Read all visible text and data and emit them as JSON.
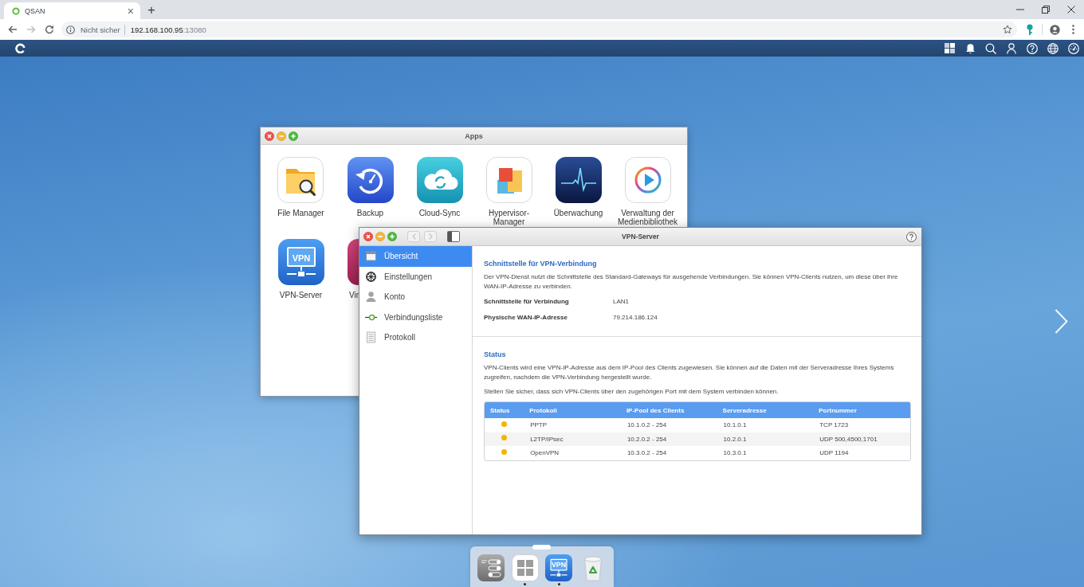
{
  "browser": {
    "tab": {
      "title": "QSAN",
      "close": "×"
    },
    "new_tab": "+",
    "forward_disabled": true,
    "address": {
      "security": "Nicht sicher",
      "host": "192.168.100.95",
      "port": ":13080"
    }
  },
  "apps_window": {
    "title": "Apps",
    "apps": [
      {
        "label": "File Manager",
        "kind": "files"
      },
      {
        "label": "Backup",
        "kind": "backup"
      },
      {
        "label": "Cloud-Sync",
        "kind": "cloud"
      },
      {
        "label": "Hypervisor-Manager",
        "kind": "hypervisor"
      },
      {
        "label": "Überwachung",
        "kind": "monitor"
      },
      {
        "label": "Verwaltung der Medienbibliothek",
        "kind": "media"
      },
      {
        "label": "VPN-Server",
        "kind": "vpn",
        "badge": "VPN"
      },
      {
        "label": "Vir",
        "kind": "partial"
      }
    ]
  },
  "vpn_window": {
    "title": "VPN-Server",
    "back_disabled": true,
    "forward_disabled": true,
    "sidebar": [
      {
        "label": "Übersicht",
        "kind": "overview",
        "selected": true
      },
      {
        "label": "Einstellungen",
        "kind": "settings",
        "selected": false
      },
      {
        "label": "Konto",
        "kind": "account",
        "selected": false
      },
      {
        "label": "Verbindungsliste",
        "kind": "connections",
        "selected": false
      },
      {
        "label": "Protokoll",
        "kind": "log",
        "selected": false
      }
    ],
    "interface": {
      "heading": "Schnittstelle für VPN-Verbindung",
      "text": "Der VPN-Dienst nutzt die Schnittstelle des Standard-Gateways für ausgehende Verbindungen. Sie können VPN-Clients nutzen, um diese über ihre WAN-IP-Adresse zu verbinden.",
      "fields": [
        {
          "label": "Schnittstelle für Verbindung",
          "value": "LAN1"
        },
        {
          "label": "Physische WAN-IP-Adresse",
          "value": "79.214.186.124"
        }
      ]
    },
    "status": {
      "heading": "Status",
      "paragraphs": [
        "VPN-Clients wird eine VPN-IP-Adresse aus dem IP-Pool des Clients zugewiesen. Sie können auf die Daten mit der Serveradresse Ihres Systems zugreifen, nachdem die VPN-Verbindung hergestellt wurde.",
        "Stellen Sie sicher, dass sich VPN-Clients über den zugehörigen Port mit dem System verbinden können."
      ],
      "table": {
        "columns": [
          "Status",
          "Protokoll",
          "IP-Pool des Clients",
          "Serveradresse",
          "Portnummer"
        ],
        "rows": [
          {
            "color": "#f5b301",
            "cells": [
              "",
              "PPTP",
              "10.1.0.2 - 254",
              "10.1.0.1",
              "TCP 1723"
            ]
          },
          {
            "color": "#f5b301",
            "cells": [
              "",
              "L2TP/IPsec",
              "10.2.0.2 - 254",
              "10.2.0.1",
              "UDP 500,4500,1701"
            ]
          },
          {
            "color": "#f5b301",
            "cells": [
              "",
              "OpenVPN",
              "10.3.0.2 - 254",
              "10.3.0.1",
              "UDP 1194"
            ]
          }
        ]
      }
    }
  },
  "dock": {
    "items": [
      {
        "kind": "settings",
        "running": false
      },
      {
        "kind": "apps",
        "running": true
      },
      {
        "kind": "vpn",
        "running": true,
        "badge": "VPN"
      },
      {
        "kind": "trash",
        "running": false
      }
    ]
  }
}
